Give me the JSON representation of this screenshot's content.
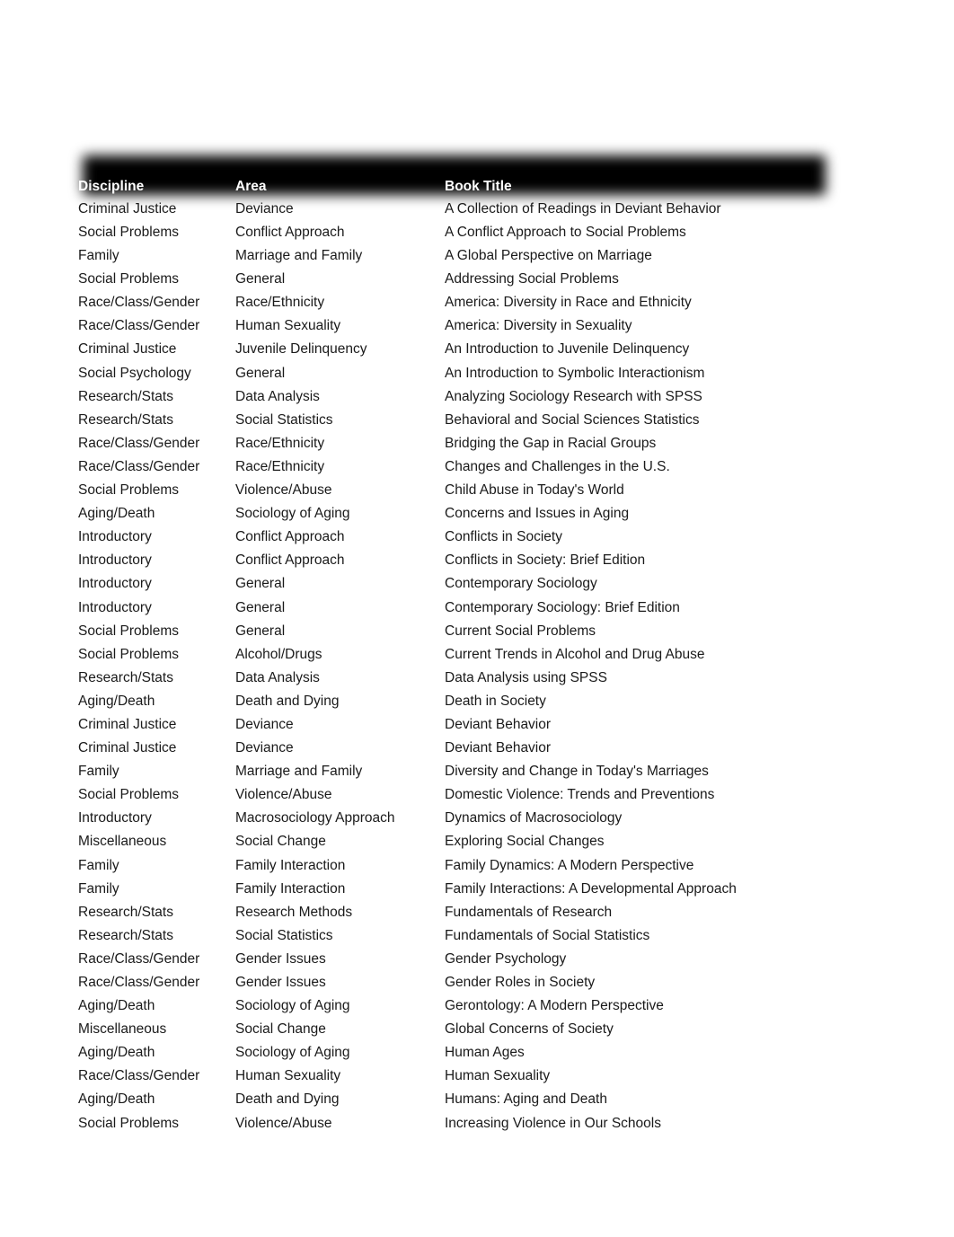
{
  "document": {
    "title": "Book Title Listing",
    "page_background": "#ffffff",
    "header_band_color": "#000000",
    "header_text_color": "#ffffff",
    "body_text_color": "#1a1a1a"
  },
  "table": {
    "columns": [
      {
        "key": "discipline",
        "label": "Discipline"
      },
      {
        "key": "area",
        "label": "Area"
      },
      {
        "key": "title",
        "label": "Book Title"
      }
    ],
    "rows": [
      {
        "discipline": "Criminal Justice",
        "area": "Deviance",
        "title": "A Collection of Readings in Deviant Behavior"
      },
      {
        "discipline": "Social Problems",
        "area": "Conflict Approach",
        "title": "A Conflict Approach to Social Problems"
      },
      {
        "discipline": "Family",
        "area": "Marriage and Family",
        "title": "A Global Perspective on Marriage"
      },
      {
        "discipline": "Social Problems",
        "area": "General",
        "title": "Addressing Social Problems"
      },
      {
        "discipline": "Race/Class/Gender",
        "area": "Race/Ethnicity",
        "title": "America: Diversity in Race and Ethnicity"
      },
      {
        "discipline": "Race/Class/Gender",
        "area": "Human Sexuality",
        "title": "America: Diversity in Sexuality"
      },
      {
        "discipline": "Criminal Justice",
        "area": "Juvenile Delinquency",
        "title": "An Introduction to Juvenile Delinquency"
      },
      {
        "discipline": "Social Psychology",
        "area": "General",
        "title": "An Introduction to Symbolic Interactionism"
      },
      {
        "discipline": "Research/Stats",
        "area": "Data Analysis",
        "title": "Analyzing Sociology Research with SPSS"
      },
      {
        "discipline": "Research/Stats",
        "area": "Social Statistics",
        "title": "Behavioral and Social Sciences Statistics"
      },
      {
        "discipline": "Race/Class/Gender",
        "area": "Race/Ethnicity",
        "title": "Bridging the Gap in Racial Groups"
      },
      {
        "discipline": "Race/Class/Gender",
        "area": "Race/Ethnicity",
        "title": "Changes and Challenges in the U.S."
      },
      {
        "discipline": "Social Problems",
        "area": "Violence/Abuse",
        "title": "Child Abuse in Today's World"
      },
      {
        "discipline": "Aging/Death",
        "area": "Sociology of Aging",
        "title": "Concerns and Issues in Aging"
      },
      {
        "discipline": "Introductory",
        "area": "Conflict Approach",
        "title": "Conflicts in Society"
      },
      {
        "discipline": "Introductory",
        "area": "Conflict Approach",
        "title": "Conflicts in Society: Brief Edition"
      },
      {
        "discipline": "Introductory",
        "area": "General",
        "title": "Contemporary Sociology"
      },
      {
        "discipline": "Introductory",
        "area": "General",
        "title": "Contemporary Sociology: Brief Edition"
      },
      {
        "discipline": "Social Problems",
        "area": "General",
        "title": "Current Social Problems"
      },
      {
        "discipline": "Social Problems",
        "area": "Alcohol/Drugs",
        "title": "Current Trends in Alcohol and Drug Abuse"
      },
      {
        "discipline": "Research/Stats",
        "area": "Data Analysis",
        "title": "Data Analysis using SPSS"
      },
      {
        "discipline": "Aging/Death",
        "area": "Death and Dying",
        "title": "Death in Society"
      },
      {
        "discipline": "Criminal Justice",
        "area": "Deviance",
        "title": "Deviant Behavior"
      },
      {
        "discipline": "Criminal Justice",
        "area": "Deviance",
        "title": "Deviant Behavior"
      },
      {
        "discipline": "Family",
        "area": "Marriage and Family",
        "title": "Diversity and Change in Today's Marriages"
      },
      {
        "discipline": "Social Problems",
        "area": "Violence/Abuse",
        "title": "Domestic Violence: Trends and Preventions"
      },
      {
        "discipline": "Introductory",
        "area": "Macrosociology Approach",
        "title": "Dynamics of Macrosociology"
      },
      {
        "discipline": "Miscellaneous",
        "area": "Social Change",
        "title": "Exploring Social Changes"
      },
      {
        "discipline": "Family",
        "area": "Family Interaction",
        "title": "Family Dynamics: A Modern Perspective"
      },
      {
        "discipline": "Family",
        "area": "Family Interaction",
        "title": "Family Interactions: A Developmental Approach"
      },
      {
        "discipline": "Research/Stats",
        "area": "Research Methods",
        "title": "Fundamentals of Research"
      },
      {
        "discipline": "Research/Stats",
        "area": "Social Statistics",
        "title": "Fundamentals of Social Statistics"
      },
      {
        "discipline": "Race/Class/Gender",
        "area": "Gender Issues",
        "title": "Gender Psychology"
      },
      {
        "discipline": "Race/Class/Gender",
        "area": "Gender Issues",
        "title": "Gender Roles in Society"
      },
      {
        "discipline": "Aging/Death",
        "area": "Sociology of Aging",
        "title": "Gerontology: A Modern Perspective"
      },
      {
        "discipline": "Miscellaneous",
        "area": "Social Change",
        "title": "Global Concerns of Society"
      },
      {
        "discipline": "Aging/Death",
        "area": "Sociology of Aging",
        "title": "Human Ages"
      },
      {
        "discipline": "Race/Class/Gender",
        "area": "Human Sexuality",
        "title": "Human Sexuality"
      },
      {
        "discipline": "Aging/Death",
        "area": "Death and Dying",
        "title": "Humans: Aging and Death"
      },
      {
        "discipline": "Social Problems",
        "area": "Violence/Abuse",
        "title": "Increasing Violence in Our Schools"
      }
    ]
  }
}
